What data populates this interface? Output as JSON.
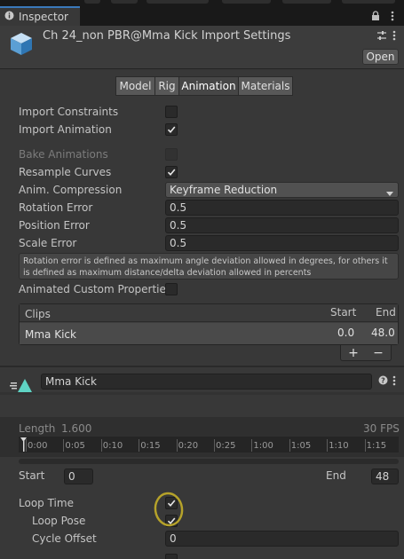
{
  "tab": {
    "label": "Inspector"
  },
  "header": {
    "title": "Ch 24_non PBR@Mma Kick Import Settings",
    "open_label": "Open"
  },
  "tabs": [
    "Model",
    "Rig",
    "Animation",
    "Materials"
  ],
  "selected_tab": "Animation",
  "fields": {
    "import_constraints": "Import Constraints",
    "import_animation": "Import Animation",
    "bake_animations": "Bake Animations",
    "resample_curves": "Resample Curves",
    "anim_compression": "Anim. Compression",
    "anim_compression_value": "Keyframe Reduction",
    "rotation_error": "Rotation Error",
    "rotation_error_value": "0.5",
    "position_error": "Position Error",
    "position_error_value": "0.5",
    "scale_error": "Scale Error",
    "scale_error_value": "0.5",
    "help": "Rotation error is defined as maximum angle deviation allowed in degrees, for others it is defined as maximum distance/delta deviation allowed in percents",
    "animated_custom_properties": "Animated Custom Properties"
  },
  "clips": {
    "header": "Clips",
    "col_start": "Start",
    "col_end": "End",
    "rows": [
      {
        "name": "Mma Kick",
        "start": "0.0",
        "end": "48.0"
      }
    ],
    "add": "+",
    "remove": "−"
  },
  "clip": {
    "name": "Mma Kick",
    "length_label": "Length",
    "length_value": "1.600",
    "fps": "30 FPS",
    "ticks": [
      "0:00",
      "0:05",
      "0:10",
      "0:15",
      "0:20",
      "0:25",
      "1:00",
      "1:05",
      "1:10",
      "1:15"
    ],
    "start_label": "Start",
    "start_value": "0",
    "end_label": "End",
    "end_value": "48",
    "loop_time": "Loop Time",
    "loop_pose": "Loop Pose",
    "cycle_offset": "Cycle Offset",
    "cycle_offset_value": "0"
  },
  "checks": {
    "import_constraints": false,
    "import_animation": true,
    "bake_animations": false,
    "resample_curves": true,
    "animated_custom_properties": false,
    "loop_time": true,
    "loop_pose": true
  },
  "colors": {
    "accent": "#3a79bb",
    "highlight_circle": "#b5a22a",
    "play_icon": "#5fd3c4"
  }
}
